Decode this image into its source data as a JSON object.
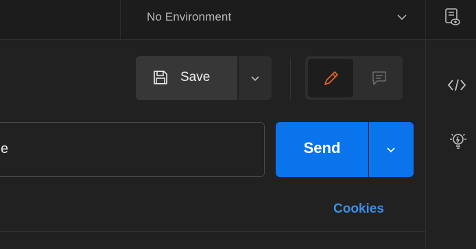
{
  "environment": {
    "selected": "No Environment"
  },
  "toolbar": {
    "save_label": "Save"
  },
  "request": {
    "url_visible_text": "e",
    "send_label": "Send",
    "cookies_label": "Cookies"
  },
  "icons": {
    "env_caret": "chevron-down-icon",
    "env_quicklook": "environment-quick-look-icon",
    "save": "floppy-disk-icon",
    "save_caret": "chevron-down-icon",
    "edit": "pencil-icon",
    "comment": "comment-icon",
    "send_caret": "chevron-down-icon",
    "code": "code-icon",
    "bulb": "lightbulb-icon"
  },
  "colors": {
    "background": "#212121",
    "topbar": "#1c1c1c",
    "send_button": "#0a74ed",
    "cookies_link": "#3d8fe6",
    "pencil_accent": "#e3642a"
  }
}
